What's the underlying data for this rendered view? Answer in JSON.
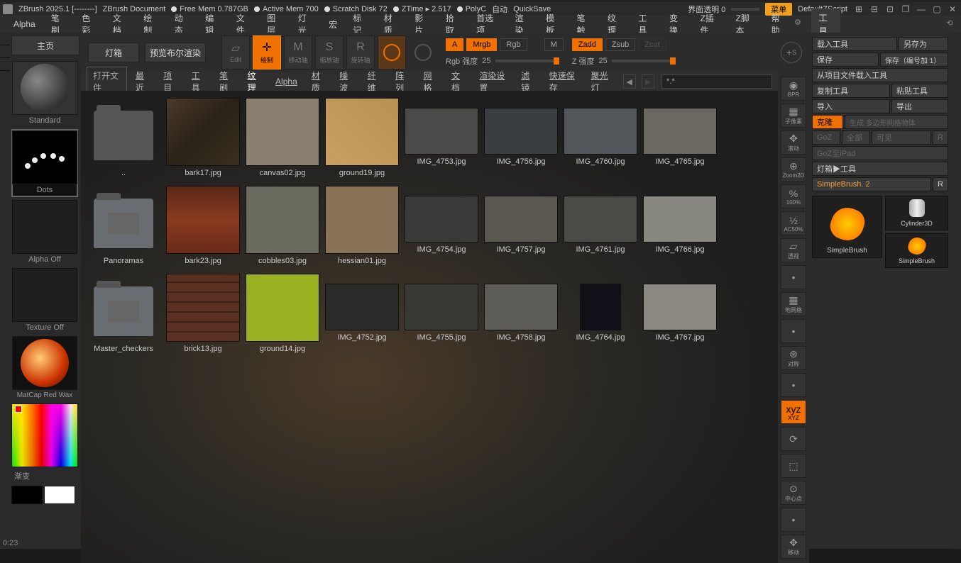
{
  "titlebar": {
    "app": "ZBrush 2025.1 [--------]",
    "doc": "ZBrush Document",
    "free_mem": "Free Mem 0.787GB",
    "active_mem": "Active Mem 700",
    "scratch": "Scratch Disk 72",
    "ztime": "ZTime ▸ 2.517",
    "polyc": "PolyC",
    "auto": "自动",
    "quicksave": "QuickSave",
    "ui_trans": "界面透明 0",
    "menu": "菜单",
    "script": "DefaultZScript"
  },
  "menu": [
    "Alpha",
    "笔刷",
    "色彩",
    "文档",
    "绘制",
    "动态",
    "编辑",
    "文件",
    "图层",
    "灯光",
    "宏",
    "标记",
    "材质",
    "影片",
    "拾取",
    "首选项",
    "渲染",
    "模板",
    "笔触",
    "纹理",
    "工具",
    "变换",
    "Z插件",
    "Z脚本",
    "帮助"
  ],
  "tools_label": "工具",
  "left": {
    "home": "主页",
    "lightbox": "灯箱",
    "preview": "预览布尔渲染",
    "brush": "Standard",
    "dots": "Dots",
    "alpha_off": "Alpha Off",
    "texture_off": "Texture Off",
    "matcap": "MatCap Red Wax",
    "gradient": "渐变"
  },
  "toolbar": {
    "edit": "Edit",
    "draw": "绘制",
    "move": "移动轴",
    "scale": "缩放轴",
    "rotate": "旋转轴",
    "a": "A",
    "mrgb": "Mrgb",
    "rgb": "Rgb",
    "m": "M",
    "zadd": "Zadd",
    "zsub": "Zsub",
    "zcut": "Zcut",
    "rgb_intensity_label": "Rgb 强度",
    "rgb_intensity_value": "25",
    "z_intensity_label": "Z 强度",
    "z_intensity_value": "25"
  },
  "browser": {
    "open": "打开文件",
    "tabs": [
      "最近",
      "项目",
      "工具",
      "笔刷",
      "纹理",
      "Alpha",
      "材质",
      "噪波",
      "纤维",
      "阵列",
      "网格",
      "文档",
      "渲染设置",
      "滤镜",
      "快速保存",
      "聚光灯"
    ],
    "active_tab": 4,
    "search": "*.*"
  },
  "thumbs": {
    "r1": [
      {
        "name": "..",
        "type": "folder"
      },
      {
        "name": "bark17.jpg",
        "bg": "linear-gradient(135deg,#4a3a2a,#2a2218,#3a3020)"
      },
      {
        "name": "canvas02.jpg",
        "bg": "#8a8070"
      },
      {
        "name": "ground19.jpg",
        "bg": "linear-gradient(45deg,#c8a060,#b89050)"
      },
      {
        "name": "IMG_4753.jpg",
        "bg": "#4a4a48",
        "short": true
      },
      {
        "name": "IMG_4756.jpg",
        "bg": "#3a3e42",
        "short": true
      },
      {
        "name": "IMG_4760.jpg",
        "bg": "#52565a",
        "short": true
      },
      {
        "name": "IMG_4765.jpg",
        "bg": "#6a6860",
        "short": true
      }
    ],
    "r2": [
      {
        "name": "Panoramas",
        "type": "folder",
        "multi": true
      },
      {
        "name": "bark23.jpg",
        "bg": "linear-gradient(0deg,#6a2a18,#8a3a20,#5a2818)"
      },
      {
        "name": "cobbles03.jpg",
        "bg": "#6a6a5e"
      },
      {
        "name": "hessian01.jpg",
        "bg": "#8a7258"
      },
      {
        "name": "IMG_4754.jpg",
        "bg": "#3a3a38",
        "short": true
      },
      {
        "name": "IMG_4757.jpg",
        "bg": "#5a5850",
        "short": true
      },
      {
        "name": "IMG_4761.jpg",
        "bg": "#4a4a46",
        "short": true
      },
      {
        "name": "IMG_4766.jpg",
        "bg": "#888880",
        "short": true
      }
    ],
    "r3": [
      {
        "name": "Master_checkers",
        "type": "folder",
        "multi": true
      },
      {
        "name": "brick13.jpg",
        "bg": "repeating-linear-gradient(0deg,#5a3020 0 12px,#3a2018 12px 14px)"
      },
      {
        "name": "ground14.jpg",
        "bg": "#9ab020"
      },
      {
        "name": "IMG_4752.jpg",
        "bg": "#2a2a28",
        "short": true,
        "w": 110
      },
      {
        "name": "IMG_4755.jpg",
        "bg": "#383834",
        "short": true
      },
      {
        "name": "IMG_4758.jpg",
        "bg": "#5e5c56",
        "short": true
      },
      {
        "name": "IMG_4764.jpg",
        "bg": "#101018",
        "short": true,
        "narrow": true
      },
      {
        "name": "IMG_4767.jpg",
        "bg": "#8a8880",
        "short": true
      }
    ]
  },
  "righttools": [
    "BPR",
    "子像素",
    "滚动",
    "Zoom2D",
    "100%",
    "AC50%",
    "透视",
    "",
    "地网格",
    "",
    "对称",
    "",
    "XYZ",
    "",
    "",
    "中心点",
    "",
    "移动"
  ],
  "rightpanel": {
    "load_tool": "载入工具",
    "save_as": "另存为",
    "save": "保存",
    "save_inc": "保存（编号加 1）",
    "load_from_project": "从项目文件载入工具",
    "copy": "复制工具",
    "paste": "粘贴工具",
    "import": "导入",
    "export": "导出",
    "clone": "克隆",
    "gen": "生成 多边形网格物体",
    "goz": "GoZ",
    "all": "全部",
    "visible": "可见",
    "r": "R",
    "goz_ipad": "GoZ至iPad",
    "lightbox_tools": "灯箱▶工具",
    "current": "SimpleBrush. 2",
    "r2": "R",
    "tool1": "SimpleBrush",
    "tool2": "SimpleBrush",
    "tool_cyl": "Cylinder3D"
  },
  "status": "0:23"
}
